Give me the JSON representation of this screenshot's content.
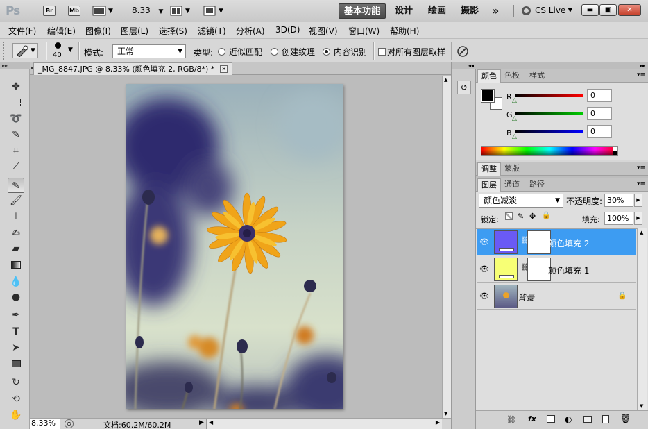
{
  "titlebar": {
    "logo": "Ps",
    "br": "Br",
    "mb": "Mb",
    "zoom": "8.33",
    "workspaces": [
      "基本功能",
      "设计",
      "绘画",
      "摄影"
    ],
    "more": "»",
    "cslive": "CS Live"
  },
  "menubar": [
    "文件(F)",
    "编辑(E)",
    "图像(I)",
    "图层(L)",
    "选择(S)",
    "滤镜(T)",
    "分析(A)",
    "3D(D)",
    "视图(V)",
    "窗口(W)",
    "帮助(H)"
  ],
  "options": {
    "brush_size": "40",
    "mode_label": "模式:",
    "mode_value": "正常",
    "type_label": "类型:",
    "type_options": [
      "近似匹配",
      "创建纹理",
      "内容识别"
    ],
    "type_selected": 2,
    "sample_all": "对所有图层取样"
  },
  "document": {
    "tab_title": "_MG_8847.JPG @ 8.33% (颜色填充 2, RGB/8*) *",
    "zoom": "8.33%",
    "doc_size": "文档:60.2M/60.2M"
  },
  "color_panel": {
    "tabs": [
      "颜色",
      "色板",
      "样式"
    ],
    "r_label": "R",
    "g_label": "G",
    "b_label": "B",
    "r": "0",
    "g": "0",
    "b": "0"
  },
  "adjust_panel": {
    "tabs": [
      "调整",
      "蒙版"
    ]
  },
  "layers_panel": {
    "tabs": [
      "图层",
      "通道",
      "路径"
    ],
    "blend_mode": "颜色减淡",
    "opacity_label": "不透明度:",
    "opacity": "30%",
    "lock_label": "锁定:",
    "fill_label": "填充:",
    "fill": "100%",
    "layers": [
      {
        "name": "颜色填充 2",
        "color": "#6a5af5",
        "selected": true
      },
      {
        "name": "颜色填充 1",
        "color": "#f7ff75",
        "selected": false
      },
      {
        "name": "背景",
        "color": null,
        "selected": false
      }
    ]
  }
}
